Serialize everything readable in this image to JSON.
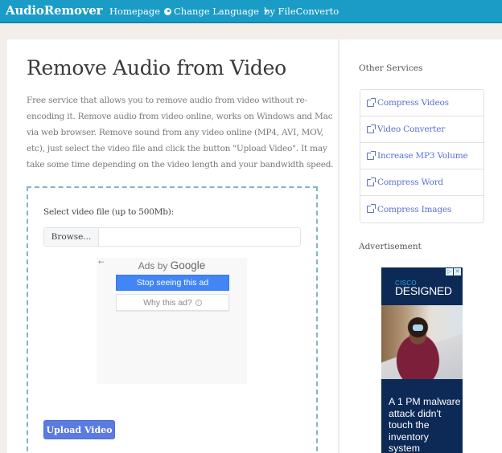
{
  "navbar": {
    "brand": "AudioRemover",
    "links": {
      "homepage": "Homepage",
      "change_language": "Change Language",
      "by": "by FileConverto"
    },
    "color": "#1a9cc6"
  },
  "main": {
    "title": "Remove Audio from Video",
    "description": "Free service that allows you to remove audio from video without re-encoding it. Remove audio from video online, works on Windows and Mac via web browser. Remove sound from any video online (MP4, AVI, MOV, etc), just select the video file and click the button \"Upload Video\". It may take some time depending on the video length and your bandwidth speed.",
    "file_label": "Select video file (up to 500Mb):",
    "browse_label": "Browse...",
    "file_value": "",
    "upload_label": "Upload Video",
    "ad": {
      "back_icon": "←",
      "ads_by": "Ads by",
      "google": "Google",
      "stop_label": "Stop seeing this ad",
      "why_label": "Why this ad?",
      "info_icon": "i"
    }
  },
  "sidebar": {
    "title": "Other Services",
    "services": [
      {
        "label": "Compress Videos"
      },
      {
        "label": "Video Converter"
      },
      {
        "label": "Increase MP3 Volume"
      },
      {
        "label": "Compress Word"
      },
      {
        "label": "Compress Images"
      }
    ],
    "advertisement_title": "Advertisement",
    "banner": {
      "adchoices_icon": "▷",
      "close_icon": "✕",
      "brand": "CISCO",
      "headline": "DESIGNED",
      "text": "A 1 PM malware attack didn't touch the inventory system"
    }
  }
}
